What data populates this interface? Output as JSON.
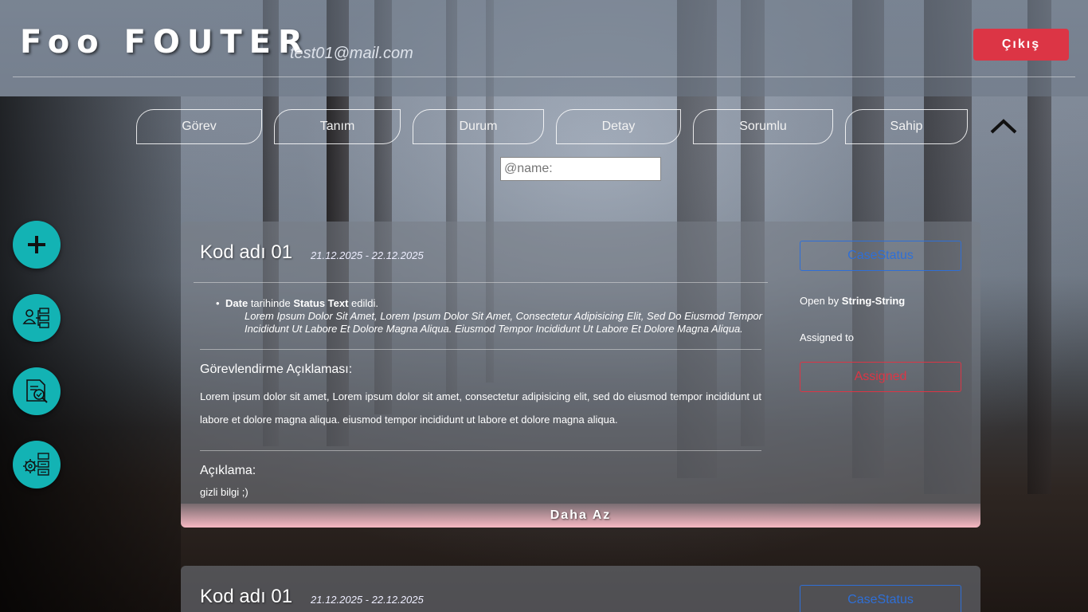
{
  "header": {
    "logo": "Foo FOUTER",
    "email": "test01@mail.com",
    "logout_label": "Çıkış"
  },
  "filters": {
    "tabs": [
      "Görev",
      "Tanım",
      "Durum",
      "Detay",
      "Sorumlu",
      "Sahip"
    ],
    "search_placeholder": "@name:",
    "collapse_icon": "chevron-up-icon"
  },
  "sidebar": {
    "buttons": [
      {
        "icon": "plus-icon"
      },
      {
        "icon": "user-hierarchy-icon"
      },
      {
        "icon": "document-search-icon"
      },
      {
        "icon": "gear-list-icon"
      }
    ]
  },
  "colors": {
    "accent": "#13b3b4",
    "danger": "#dc3545",
    "primary": "#2f6fd6"
  },
  "cards": [
    {
      "title": "Kod adı 01",
      "dates": "21.12.2025 - 22.12.2025",
      "status_label": "CaseStatus",
      "history": {
        "date_word": "Date",
        "mid1": "tarihinde",
        "status_word": "Status Text",
        "mid2": "edildi.",
        "lorem": "Lorem Ipsum Dolor Sit Amet, Lorem Ipsum Dolor Sit Amet, Consectetur Adipisicing Elit, Sed Do Eiusmod Tempor Incididunt Ut Labore Et Dolore Magna Aliqua. Eiusmod Tempor Incididunt Ut Labore Et Dolore Magna Aliqua."
      },
      "assignment_title": "Görevlendirme Açıklaması:",
      "assignment_text": "Lorem ipsum dolor sit amet, Lorem ipsum dolor sit amet, consectetur adipisicing elit, sed do eiusmod tempor incididunt ut labore et dolore magna aliqua. eiusmod tempor incididunt ut labore et dolore magna aliqua.",
      "description_title": "Açıklama:",
      "description_text": "gizli bilgi ;)",
      "open_by_prefix": "Open by",
      "open_by_name": "String-String",
      "assigned_to_label": "Assigned to",
      "assigned_button": "Assigned",
      "less_label": "Daha Az"
    },
    {
      "title": "Kod adı 01",
      "dates": "21.12.2025 - 22.12.2025",
      "status_label": "CaseStatus"
    }
  ]
}
